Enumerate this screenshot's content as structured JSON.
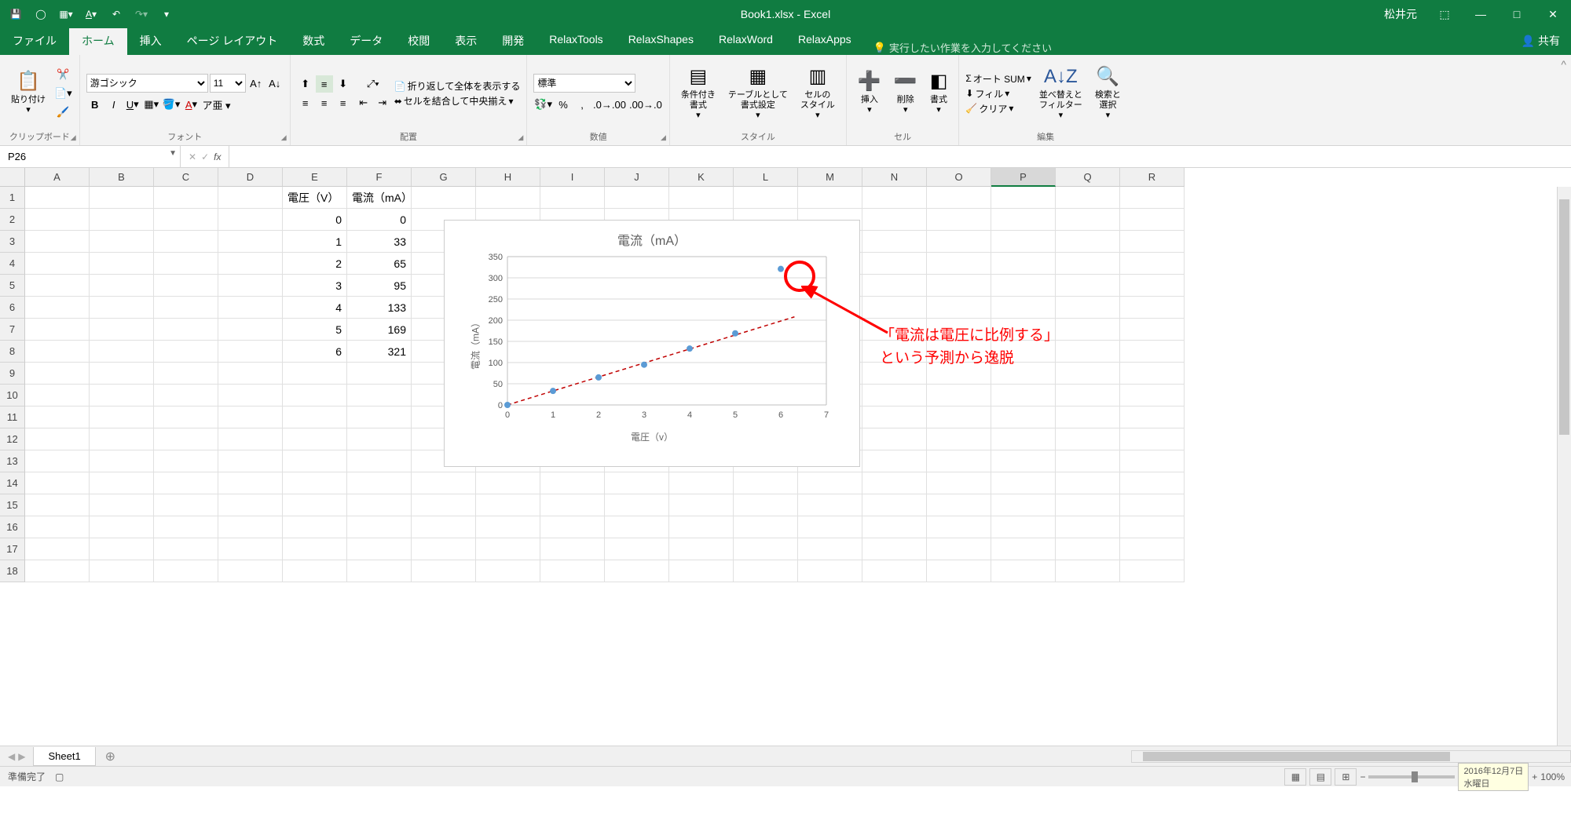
{
  "title": {
    "file": "Book1.xlsx",
    "app": "Excel",
    "user": "松井元"
  },
  "tabs": {
    "items": [
      "ファイル",
      "ホーム",
      "挿入",
      "ページ レイアウト",
      "数式",
      "データ",
      "校閲",
      "表示",
      "開発",
      "RelaxTools",
      "RelaxShapes",
      "RelaxWord",
      "RelaxApps"
    ],
    "active": 1,
    "tell_me": "実行したい作業を入力してください",
    "share": "共有"
  },
  "ribbon": {
    "clipboard": {
      "label": "クリップボード",
      "paste": "貼り付け"
    },
    "font": {
      "label": "フォント",
      "name": "游ゴシック",
      "size": "11"
    },
    "alignment": {
      "label": "配置",
      "wrap": "折り返して全体を表示する",
      "merge": "セルを結合して中央揃え"
    },
    "number": {
      "label": "数値",
      "format": "標準"
    },
    "styles": {
      "label": "スタイル",
      "conditional": "条件付き\n書式",
      "table": "テーブルとして\n書式設定",
      "cell": "セルの\nスタイル"
    },
    "cells": {
      "label": "セル",
      "insert": "挿入",
      "delete": "削除",
      "format": "書式"
    },
    "editing": {
      "label": "編集",
      "autosum": "オート SUM",
      "fill": "フィル",
      "clear": "クリア",
      "sort": "並べ替えと\nフィルター",
      "find": "検索と\n選択"
    }
  },
  "formulabar": {
    "name": "P26",
    "formula": ""
  },
  "columns": [
    "A",
    "B",
    "C",
    "D",
    "E",
    "F",
    "G",
    "H",
    "I",
    "J",
    "K",
    "L",
    "M",
    "N",
    "O",
    "P",
    "Q",
    "R"
  ],
  "selected_col": "P",
  "row_count": 18,
  "table": {
    "headers": {
      "e": "電圧（V）",
      "f": "電流（mA）"
    },
    "rows": [
      {
        "e": "0",
        "f": "0"
      },
      {
        "e": "1",
        "f": "33"
      },
      {
        "e": "2",
        "f": "65"
      },
      {
        "e": "3",
        "f": "95"
      },
      {
        "e": "4",
        "f": "133"
      },
      {
        "e": "5",
        "f": "169"
      },
      {
        "e": "6",
        "f": "321"
      }
    ]
  },
  "chart": {
    "title": "電流（mA）",
    "xlabel": "電圧（v）",
    "ylabel": "電流（mA）"
  },
  "chart_data": {
    "type": "scatter",
    "title": "電流（mA）",
    "xlabel": "電圧（v）",
    "ylabel": "電流（mA）",
    "x": [
      0,
      1,
      2,
      3,
      4,
      5,
      6
    ],
    "y": [
      0,
      33,
      65,
      95,
      133,
      169,
      321
    ],
    "xlim": [
      0,
      7
    ],
    "ylim": [
      0,
      350
    ],
    "xticks": [
      0,
      1,
      2,
      3,
      4,
      5,
      6,
      7
    ],
    "yticks": [
      0,
      50,
      100,
      150,
      200,
      250,
      300,
      350
    ],
    "trendline": {
      "slope": 33,
      "intercept": 0,
      "x_range": [
        0,
        6.3
      ]
    }
  },
  "annotation": {
    "line1": "「電流は電圧に比例する」",
    "line2": "という予測から逸脱"
  },
  "sheets": {
    "active": "Sheet1"
  },
  "status": {
    "ready": "準備完了",
    "zoom": "100%",
    "date": "2016年12月7日",
    "day": "水曜日"
  }
}
